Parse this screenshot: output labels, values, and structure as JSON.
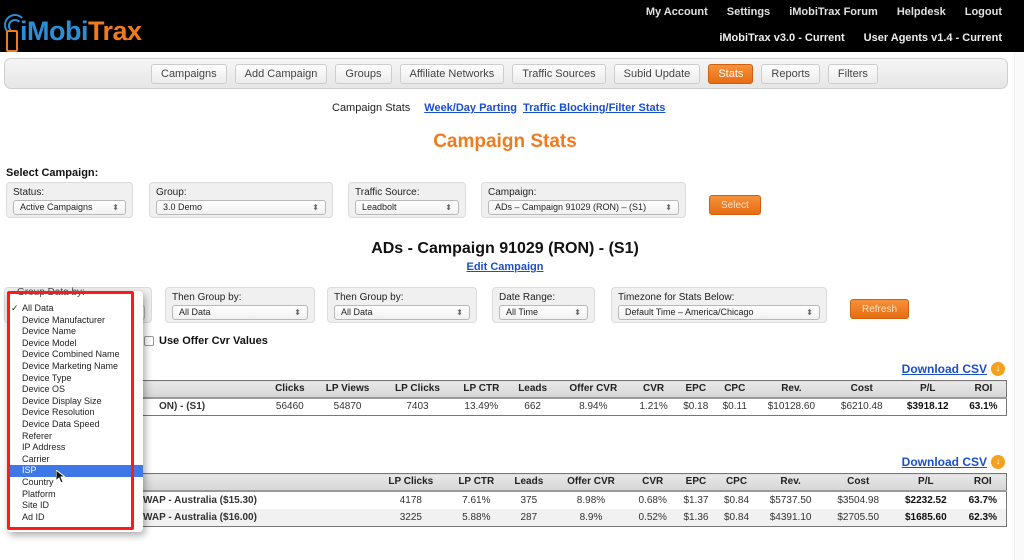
{
  "header": {
    "logo_part1": "iMobi",
    "logo_part2": "Trax",
    "top_links": [
      "My Account",
      "Settings",
      "iMobiTrax Forum",
      "Helpdesk",
      "Logout"
    ],
    "versions": [
      "iMobiTrax v3.0 - Current",
      "User Agents v1.4 - Current"
    ]
  },
  "nav": {
    "items": [
      "Campaigns",
      "Add Campaign",
      "Groups",
      "Affiliate Networks",
      "Traffic Sources",
      "Subid Update",
      "Stats",
      "Reports",
      "Filters"
    ],
    "active": "Stats"
  },
  "subnav": {
    "current": "Campaign Stats",
    "links": [
      "Week/Day Parting",
      "Traffic Blocking/Filter Stats"
    ]
  },
  "page_title": "Campaign Stats",
  "select_campaign": {
    "label": "Select Campaign:",
    "status": {
      "label": "Status:",
      "value": "Active Campaigns"
    },
    "group": {
      "label": "Group:",
      "value": "3.0 Demo"
    },
    "traffic_source": {
      "label": "Traffic Source:",
      "value": "Leadbolt"
    },
    "campaign": {
      "label": "Campaign:",
      "value": "ADs – Campaign 91029 (RON) – (S1)"
    },
    "select_button": "Select"
  },
  "campaign_heading": "ADs - Campaign 91029 (RON) - (S1)",
  "edit_campaign": "Edit Campaign",
  "grouping": {
    "group_data_by": {
      "label": "Group Data by:",
      "value": "All Data"
    },
    "then_group_by_1": {
      "label": "Then Group by:",
      "value": "All Data"
    },
    "then_group_by_2": {
      "label": "Then Group by:",
      "value": "All Data"
    },
    "date_range": {
      "label": "Date Range:",
      "value": "All Time"
    },
    "timezone": {
      "label": "Timezone for Stats Below:",
      "value": "Default Time – America/Chicago"
    },
    "refresh_button": "Refresh",
    "use_offer_cvr": "Use Offer Cvr Values"
  },
  "dropdown": {
    "options": [
      "All Data",
      "Device Manufacturer",
      "Device Name",
      "Device Model",
      "Device Combined Name",
      "Device Marketing Name",
      "Device Type",
      "Device OS",
      "Device Display Size",
      "Device Resolution",
      "Device Data Speed",
      "Referer",
      "IP Address",
      "Carrier",
      "ISP",
      "Country",
      "Platform",
      "Site ID",
      "Ad ID"
    ],
    "checked": "All Data",
    "highlighted": "ISP",
    "check_glyph": "✓"
  },
  "download_csv": "Download CSV",
  "download_icon": "↓",
  "table1": {
    "headers": [
      "",
      "Clicks",
      "LP Views",
      "LP Clicks",
      "LP CTR",
      "Leads",
      "Offer CVR",
      "CVR",
      "EPC",
      "CPC",
      "Rev.",
      "Cost",
      "P/L",
      "ROI"
    ],
    "rows": [
      [
        "ON) - (S1)",
        "56460",
        "54870",
        "7403",
        "13.49%",
        "662",
        "8.94%",
        "1.21%",
        "$0.18",
        "$0.11",
        "$10128.60",
        "$6210.48",
        "$3918.12",
        "63.1%"
      ]
    ]
  },
  "table2": {
    "headers": [
      "",
      "LP Clicks",
      "LP CTR",
      "Leads",
      "Offer CVR",
      "CVR",
      "EPC",
      "CPC",
      "Rev.",
      "Cost",
      "P/L",
      "ROI"
    ],
    "rows": [
      [
        "WAP - Australia ($15.30)",
        "4178",
        "7.61%",
        "375",
        "8.98%",
        "0.68%",
        "$1.37",
        "$0.84",
        "$5737.50",
        "$3504.98",
        "$2232.52",
        "63.7%"
      ],
      [
        "WAP - Australia ($16.00)",
        "3225",
        "5.88%",
        "287",
        "8.9%",
        "0.52%",
        "$1.36",
        "$0.84",
        "$4391.10",
        "$2705.50",
        "$1685.60",
        "62.3%"
      ]
    ]
  },
  "colors": {
    "accent_orange": "#f07b1d",
    "link_blue": "#1a4fc7",
    "highlight_blue": "#3d78e6",
    "annotation_red": "#ff1a1a"
  }
}
